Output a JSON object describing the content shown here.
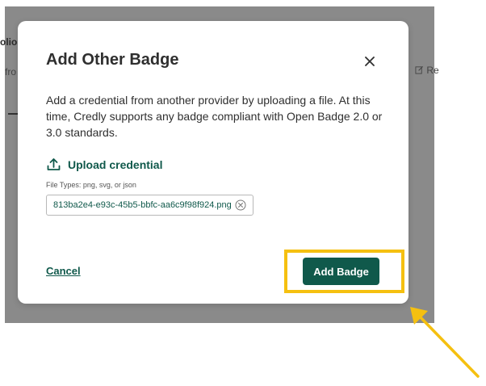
{
  "background": {
    "fragment_left_top": "olio",
    "fragment_left_mid": "fro",
    "fragment_right_mid": "Re"
  },
  "dialog": {
    "title": "Add Other Badge",
    "description": "Add a credential from another provider by uploading a file. At this time, Credly supports any badge compliant with Open Badge 2.0 or 3.0 standards.",
    "upload_label": "Upload credential",
    "file_types": "File Types: png, svg, or json",
    "file_name": "813ba2e4-e93c-45b5-bbfc-aa6c9f98f924.png",
    "cancel_label": "Cancel",
    "submit_label": "Add Badge"
  },
  "icons": {
    "close": "close-icon",
    "upload": "upload-icon",
    "remove": "remove-file-icon",
    "background_edit": "edit-icon"
  },
  "colors": {
    "accent": "#10594b",
    "highlight": "#f5c010",
    "overlay": "#8a8a8a"
  }
}
